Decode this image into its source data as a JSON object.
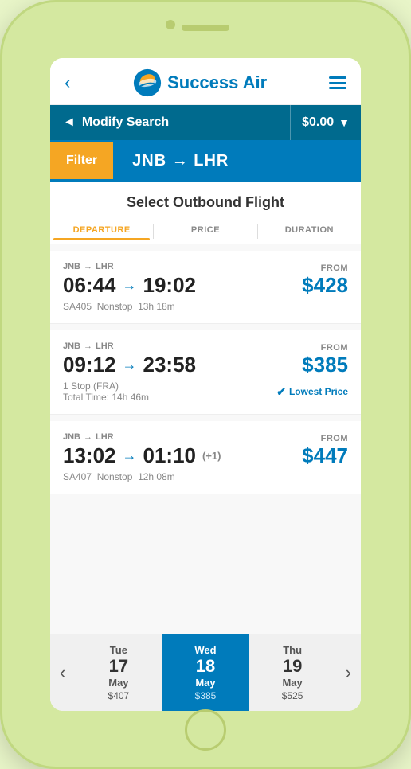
{
  "phone": {
    "header": {
      "back_label": "‹",
      "logo_text": "Success Air",
      "menu_label": "☰"
    },
    "modify_bar": {
      "arrow": "◄",
      "label": "Modify Search",
      "price": "$0.00",
      "price_arrow": "▼"
    },
    "route_bar": {
      "filter_label": "Filter",
      "route": "JNB → LHR"
    },
    "select_title": "Select Outbound Flight",
    "sort_tabs": [
      {
        "id": "departure",
        "label": "DEPARTURE",
        "active": true
      },
      {
        "id": "price",
        "label": "PRICE",
        "active": false
      },
      {
        "id": "duration",
        "label": "DURATION",
        "active": false
      }
    ],
    "flights": [
      {
        "from_code": "JNB",
        "to_code": "LHR",
        "dep_time": "06:44",
        "arr_time": "19:02",
        "plus": "",
        "flight_num": "SA405",
        "stops": "Nonstop",
        "duration": "13h 18m",
        "from_label": "FROM",
        "price": "$428",
        "badge": "",
        "badge_icon": ""
      },
      {
        "from_code": "JNB",
        "to_code": "LHR",
        "dep_time": "09:12",
        "arr_time": "23:58",
        "plus": "",
        "flight_num": "",
        "stops": "1 Stop (FRA)",
        "duration": "Total Time: 14h 46m",
        "from_label": "FROM",
        "price": "$385",
        "badge": "Lowest Price",
        "badge_icon": "✔"
      },
      {
        "from_code": "JNB",
        "to_code": "LHR",
        "dep_time": "13:02",
        "arr_time": "01:10",
        "plus": "(+1)",
        "flight_num": "SA407",
        "stops": "Nonstop",
        "duration": "12h 08m",
        "from_label": "FROM",
        "price": "$447",
        "badge": "",
        "badge_icon": ""
      }
    ],
    "date_nav": {
      "prev_arrow": "‹",
      "next_arrow": "›",
      "dates": [
        {
          "day": "Tue",
          "num": "17",
          "month": "May",
          "price": "$407",
          "active": false
        },
        {
          "day": "Wed",
          "num": "18",
          "month": "May",
          "price": "$385",
          "active": true
        },
        {
          "day": "Thu",
          "num": "19",
          "month": "May",
          "price": "$525",
          "active": false
        }
      ]
    }
  }
}
